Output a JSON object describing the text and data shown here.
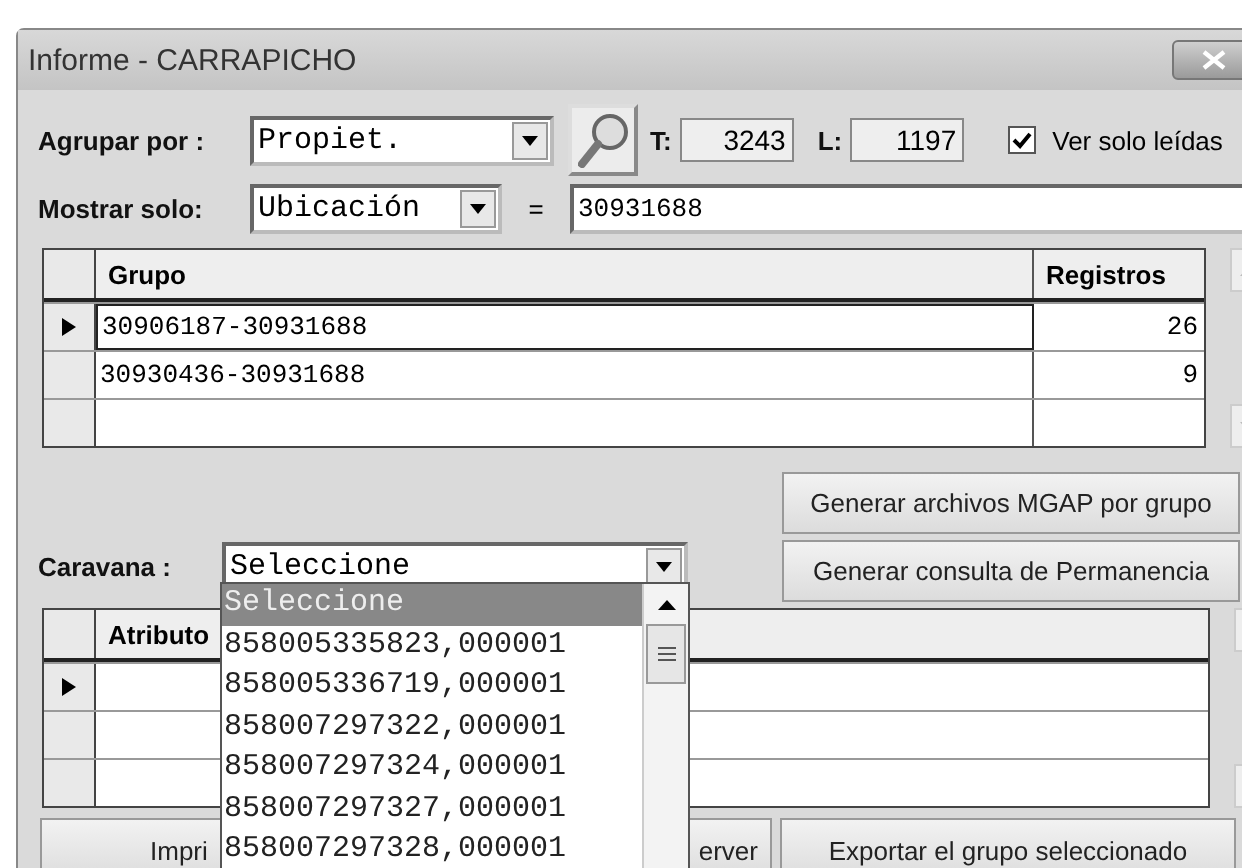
{
  "window": {
    "title": "Informe - CARRAPICHO"
  },
  "group_by": {
    "label": "Agrupar por :",
    "value": "Propiet."
  },
  "totals": [
    {
      "label": "T:",
      "value": "3243"
    },
    {
      "label": "L:",
      "value": "1197"
    }
  ],
  "only_read": {
    "label": "Ver solo leídas",
    "checked": true
  },
  "filter": {
    "label": "Mostrar solo:",
    "field": "Ubicación",
    "operator": "=",
    "value": "30931688"
  },
  "groups_table": {
    "columns": [
      "Grupo",
      "Registros"
    ],
    "rows": [
      {
        "cells": [
          "30906187-30931688",
          "26"
        ],
        "selected": true
      },
      {
        "cells": [
          "30930436-30931688",
          "9"
        ],
        "selected": false
      }
    ]
  },
  "actions": [
    "Generar archivos MGAP por grupo",
    "Generar consulta de Permanencia"
  ],
  "caravana": {
    "label": "Caravana :",
    "value": "Seleccione",
    "options": [
      {
        "label": "Seleccione",
        "selected": true
      },
      {
        "label": "858005335823,000001",
        "selected": false
      },
      {
        "label": "858005336719,000001",
        "selected": false
      },
      {
        "label": "858007297322,000001",
        "selected": false
      },
      {
        "label": "858007297324,000001",
        "selected": false
      },
      {
        "label": "858007297327,000001",
        "selected": false
      },
      {
        "label": "858007297328,000001",
        "selected": false
      }
    ]
  },
  "attributes_table": {
    "columns": [
      "Atributo"
    ],
    "rows": [
      {
        "selected": true
      },
      {
        "selected": false
      },
      {
        "selected": false
      }
    ]
  },
  "bottom_buttons": [
    [
      "Impri",
      "erver"
    ],
    [
      "Exportar el grupo seleccionado"
    ]
  ]
}
